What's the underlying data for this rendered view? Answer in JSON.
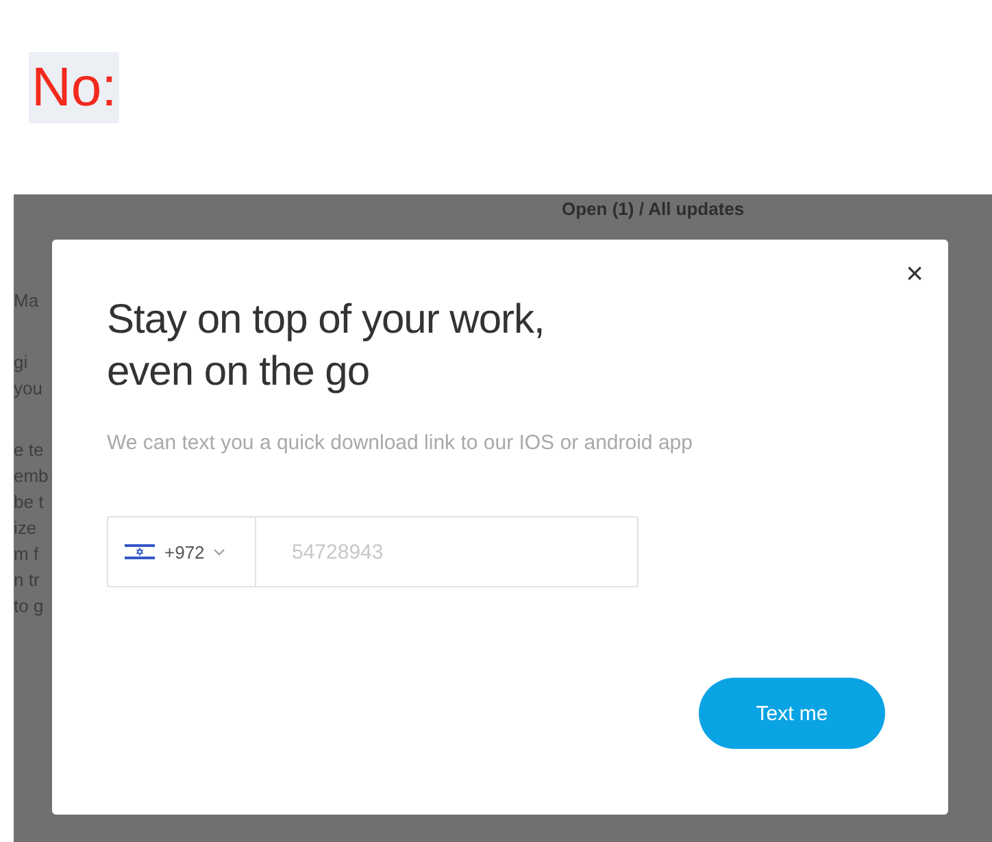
{
  "label": "No:",
  "background": {
    "header": "Open (1) / All updates",
    "fragments": [
      "Ma",
      "gi",
      "you",
      "e te",
      "emb",
      "be t",
      "ize",
      "m f",
      "n tr",
      "to g"
    ]
  },
  "dialog": {
    "close": "×",
    "title_lines": [
      "Stay on top of your work,",
      "even on the go"
    ],
    "subtitle": "We can text you a quick download link to our IOS or android app",
    "phone": {
      "country_code": "+972",
      "placeholder": "54728943"
    },
    "button": "Text me"
  }
}
